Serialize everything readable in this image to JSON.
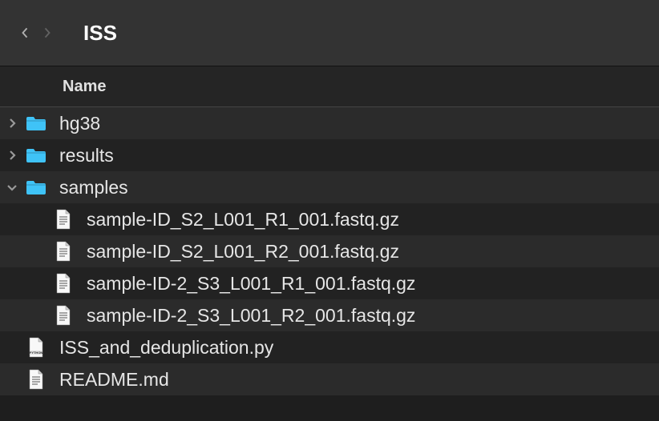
{
  "toolbar": {
    "title": "ISS"
  },
  "columns": {
    "name": "Name"
  },
  "colors": {
    "folder": "#3FC3F7",
    "file_fill": "#F8F8F8",
    "file_outline": "#9a9a9a"
  },
  "rows": [
    {
      "type": "folder",
      "level": 0,
      "name": "hg38",
      "expanded": false,
      "stripe": "even"
    },
    {
      "type": "folder",
      "level": 0,
      "name": "results",
      "expanded": false,
      "stripe": "odd"
    },
    {
      "type": "folder",
      "level": 0,
      "name": "samples",
      "expanded": true,
      "stripe": "even"
    },
    {
      "type": "file",
      "level": 1,
      "name": "sample-ID_S2_L001_R1_001.fastq.gz",
      "kind": "doc",
      "stripe": "odd"
    },
    {
      "type": "file",
      "level": 1,
      "name": "sample-ID_S2_L001_R2_001.fastq.gz",
      "kind": "doc",
      "stripe": "even"
    },
    {
      "type": "file",
      "level": 1,
      "name": "sample-ID-2_S3_L001_R1_001.fastq.gz",
      "kind": "doc",
      "stripe": "odd"
    },
    {
      "type": "file",
      "level": 1,
      "name": "sample-ID-2_S3_L001_R2_001.fastq.gz",
      "kind": "doc",
      "stripe": "even"
    },
    {
      "type": "file",
      "level": 0,
      "name": "ISS_and_deduplication.py",
      "kind": "python",
      "stripe": "odd"
    },
    {
      "type": "file",
      "level": 0,
      "name": "README.md",
      "kind": "doc",
      "stripe": "even"
    }
  ]
}
